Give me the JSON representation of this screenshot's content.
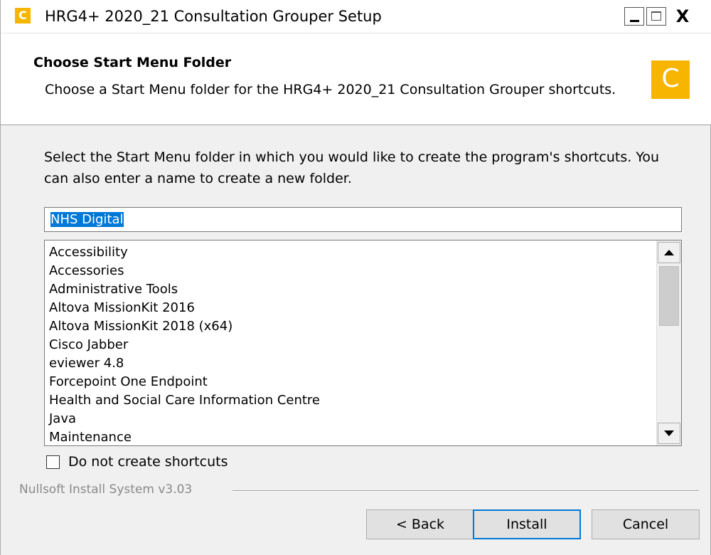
{
  "window": {
    "title": "HRG4+ 2020_21 Consultation Grouper Setup",
    "icon_letter": "C",
    "close_glyph": "X"
  },
  "header": {
    "title": "Choose Start Menu Folder",
    "subtitle": "Choose a Start Menu folder for the HRG4+ 2020_21 Consultation Grouper shortcuts.",
    "logo_letter": "C"
  },
  "body": {
    "instructions": "Select the Start Menu folder in which you would like to create the program's shortcuts. You can also enter a name to create a new folder."
  },
  "folder_input": {
    "value": "NHS Digital"
  },
  "folder_list": {
    "items": [
      "Accessibility",
      "Accessories",
      "Administrative Tools",
      "Altova MissionKit 2016",
      "Altova MissionKit 2018 (x64)",
      "Cisco Jabber",
      "eviewer 4.8",
      "Forcepoint One Endpoint",
      "Health and Social Care Information Centre",
      "Java",
      "Maintenance"
    ]
  },
  "checkbox": {
    "label": "Do not create shortcuts",
    "checked": false
  },
  "footer": {
    "branding": "Nullsoft Install System v3.03",
    "back_label": "< Back",
    "install_label": "Install",
    "cancel_label": "Cancel"
  },
  "colors": {
    "accent": "#0078d7",
    "logo": "#f7b500"
  }
}
